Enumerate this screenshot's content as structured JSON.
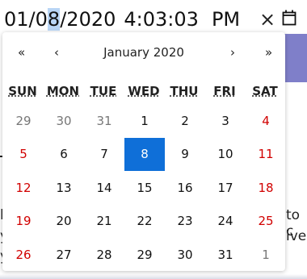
{
  "input": {
    "month": "01",
    "day": "08",
    "year": "2020",
    "hour": "4",
    "minute": "03",
    "second": "03",
    "ampm": "PM",
    "clear_glyph": "×",
    "calendar_icon": "calendar-icon"
  },
  "background": {
    "text_right_1": "to c",
    "text_right_2": "ive",
    "text_left_1": "l",
    "text_left_2": "y",
    "text_left_3": "y"
  },
  "calendar": {
    "prev_year": "«",
    "prev_month": "‹",
    "next_month": "›",
    "next_year": "»",
    "title": "January 2020",
    "weekdays": [
      "SUN",
      "MON",
      "TUE",
      "WED",
      "THU",
      "FRI",
      "SAT"
    ],
    "weeks": [
      [
        "29",
        "30",
        "31",
        "1",
        "2",
        "3",
        "4"
      ],
      [
        "5",
        "6",
        "7",
        "8",
        "9",
        "10",
        "11"
      ],
      [
        "12",
        "13",
        "14",
        "15",
        "16",
        "17",
        "18"
      ],
      [
        "19",
        "20",
        "21",
        "22",
        "23",
        "24",
        "25"
      ],
      [
        "26",
        "27",
        "28",
        "29",
        "30",
        "31",
        "1"
      ]
    ],
    "selected": "8",
    "colors": {
      "selected_bg": "#0f6fd8",
      "weekend": "#d10000",
      "other_month": "#777777"
    }
  }
}
